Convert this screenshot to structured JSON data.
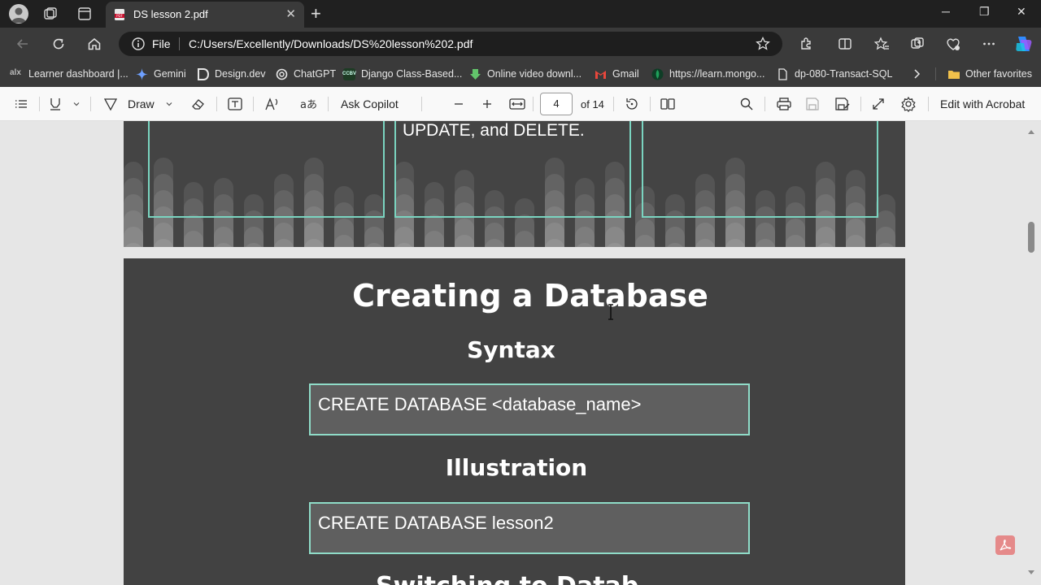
{
  "tab": {
    "title": "DS lesson 2.pdf",
    "close": "✕",
    "new_tab": "+"
  },
  "window": {
    "minimize": "─",
    "restore": "❐",
    "close": "✕"
  },
  "address": {
    "scheme": "File",
    "url": "C:/Users/Excellently/Downloads/DS%20lesson%202.pdf"
  },
  "favorites": [
    {
      "label": "Learner dashboard |...",
      "color": "#9c9c9c"
    },
    {
      "label": "Gemini",
      "color": "#6ea0ff"
    },
    {
      "label": "Design.dev",
      "color": "#d0d0d0"
    },
    {
      "label": "ChatGPT",
      "color": "#d0d0d0"
    },
    {
      "label": "Django Class-Based...",
      "color": "#2f6d3a"
    },
    {
      "label": "Online video downl...",
      "color": "#63c46b"
    },
    {
      "label": "Gmail",
      "color": "#e9473c"
    },
    {
      "label": "https://learn.mongo...",
      "color": "#1fa05a"
    },
    {
      "label": "dp-080-Transact-SQL",
      "color": "#d0d0d0"
    },
    {
      "label": "Other favorites",
      "color": "#f1c14b"
    }
  ],
  "pdf_toolbar": {
    "draw": "Draw",
    "ask_copilot": "Ask Copilot",
    "page_current": "4",
    "page_total": "of 14",
    "edit_acrobat": "Edit with Acrobat"
  },
  "pdf_page_prev": {
    "text": "UPDATE, and DELETE."
  },
  "pdf_page": {
    "title": "Creating a Database",
    "syntax_heading": "Syntax",
    "syntax_code": "CREATE DATABASE <database_name>",
    "illustration_heading": "Illustration",
    "illustration_code": "CREATE DATABASE lesson2",
    "next_heading_partial": "Switching to Datab"
  },
  "colors": {
    "accent_border": "#7ad4c0",
    "slide_bg": "#424242"
  }
}
